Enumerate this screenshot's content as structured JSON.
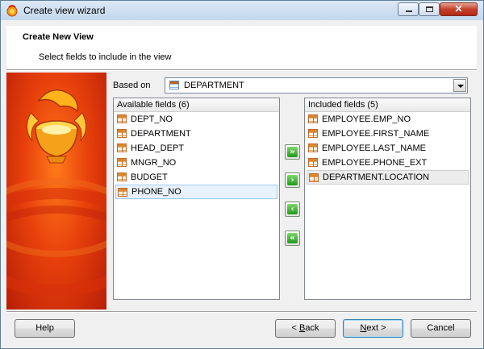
{
  "window": {
    "title": "Create view wizard",
    "close_glyph": "✕"
  },
  "header": {
    "title": "Create New View",
    "subtitle": "Select fields to include in the view"
  },
  "based_on": {
    "label": "Based on",
    "value": "DEPARTMENT"
  },
  "available": {
    "header": "Available fields (6)",
    "items": [
      "DEPT_NO",
      "DEPARTMENT",
      "HEAD_DEPT",
      "MNGR_NO",
      "BUDGET",
      "PHONE_NO"
    ],
    "selected": "PHONE_NO"
  },
  "included": {
    "header": "Included fields (5)",
    "items": [
      "EMPLOYEE.EMP_NO",
      "EMPLOYEE.FIRST_NAME",
      "EMPLOYEE.LAST_NAME",
      "EMPLOYEE.PHONE_EXT",
      "DEPARTMENT.LOCATION"
    ],
    "selected": "DEPARTMENT.LOCATION"
  },
  "move_buttons": {
    "add_all": "»",
    "add": "›",
    "remove": "‹",
    "remove_all": "«"
  },
  "buttons": {
    "help": "Help",
    "back_prefix": "< ",
    "back_mnemonic": "B",
    "back_rest": "ack",
    "next_mnemonic": "N",
    "next_rest": "ext >",
    "cancel": "Cancel"
  },
  "icons": [
    "app-icon",
    "table-icon",
    "combo-dropdown-icon",
    "minimize-icon",
    "maximize-icon",
    "close-icon"
  ]
}
